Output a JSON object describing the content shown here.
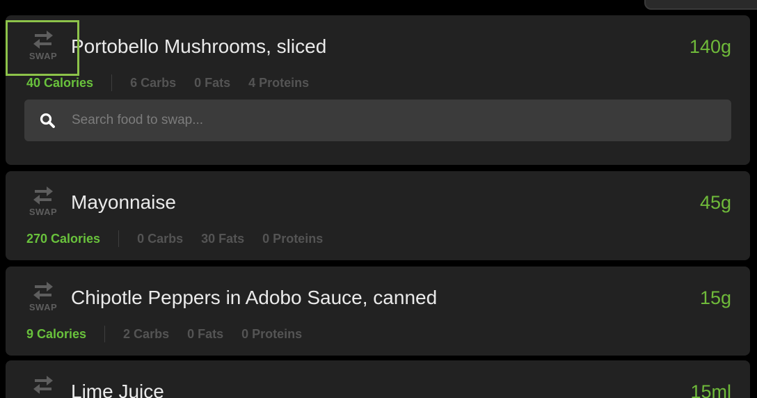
{
  "swap_label": "SWAP",
  "search": {
    "placeholder": "Search food to swap..."
  },
  "foods": [
    {
      "name": "Portobello Mushrooms, sliced",
      "amount": "140g",
      "calories": "40 Calories",
      "carbs": "6 Carbs",
      "fats": "0 Fats",
      "proteins": "4 Proteins"
    },
    {
      "name": "Mayonnaise",
      "amount": "45g",
      "calories": "270 Calories",
      "carbs": "0 Carbs",
      "fats": "30 Fats",
      "proteins": "0 Proteins"
    },
    {
      "name": "Chipotle Peppers in Adobo Sauce, canned",
      "amount": "15g",
      "calories": "9 Calories",
      "carbs": "2 Carbs",
      "fats": "0 Fats",
      "proteins": "0 Proteins"
    },
    {
      "name": "Lime Juice",
      "amount": "15ml"
    }
  ],
  "colors": {
    "accent_green": "#6fba3a",
    "highlight_border": "#8dc34a",
    "card_bg": "#222222",
    "search_bg": "#3b3b3b"
  },
  "icons": [
    "swap-arrows-icon",
    "search-icon"
  ]
}
